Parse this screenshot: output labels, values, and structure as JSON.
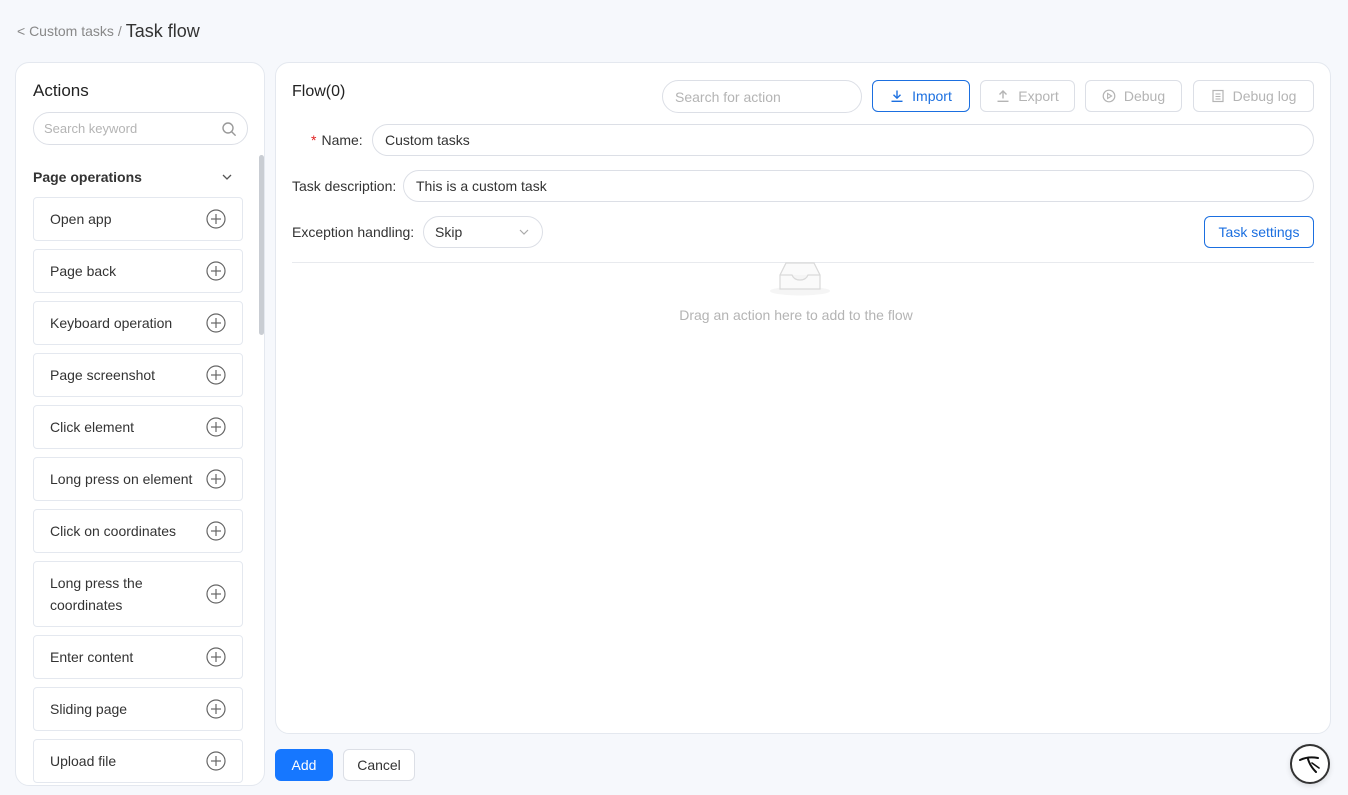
{
  "breadcrumb": {
    "back": "< Custom tasks",
    "separator": "/",
    "current": "Task flow"
  },
  "actions_panel": {
    "title": "Actions",
    "search_placeholder": "Search keyword",
    "group": "Page operations",
    "items": [
      "Open app",
      "Page back",
      "Keyboard operation",
      "Page screenshot",
      "Click element",
      "Long press on element",
      "Click on coordinates",
      "Long press the coordinates",
      "Enter content",
      "Sliding page",
      "Upload file"
    ]
  },
  "flow": {
    "title": "Flow(0)",
    "search_placeholder": "Search for action",
    "buttons": {
      "import": "Import",
      "export": "Export",
      "debug": "Debug",
      "debug_log": "Debug log"
    },
    "form": {
      "required_mark": "*",
      "name_label": "Name:",
      "name_value": "Custom tasks",
      "desc_label": "Task description:",
      "desc_value": "This is a custom task",
      "exception_label": "Exception handling:",
      "exception_value": "Skip",
      "task_settings": "Task settings"
    },
    "empty_text": "Drag an action here to add to the flow"
  },
  "footer": {
    "add": "Add",
    "cancel": "Cancel"
  },
  "colors": {
    "primary": "#1677ff",
    "accent_border": "#1b6fe0",
    "background": "#f6f8fc",
    "required": "#e02020"
  }
}
